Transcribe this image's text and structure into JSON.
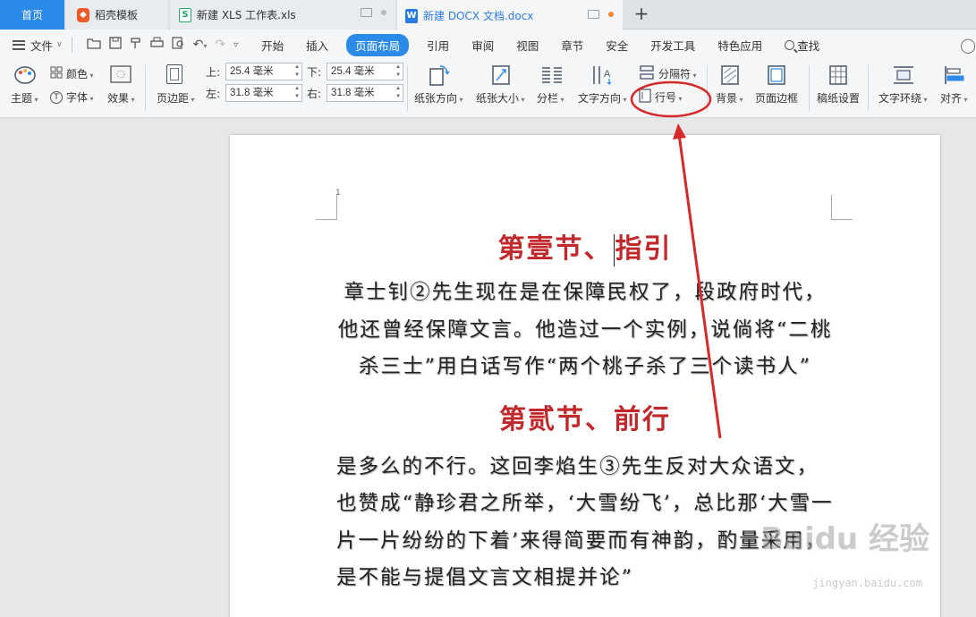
{
  "tabs": {
    "home": "首页",
    "daoke": "稻壳模板",
    "xls": "新建 XLS 工作表.xls",
    "docx": "新建 DOCX 文档.docx",
    "new_tab": "+"
  },
  "menu": {
    "file": "文件",
    "tabs": [
      "开始",
      "插入",
      "页面布局",
      "引用",
      "审阅",
      "视图",
      "章节",
      "安全",
      "开发工具",
      "特色应用"
    ],
    "active_tab": "页面布局",
    "search": "查找"
  },
  "ribbon": {
    "color": "颜色",
    "theme": "主题",
    "font": "字体",
    "effect": "效果",
    "margins": "页边距",
    "top_label": "上:",
    "top_value": "25.4 毫米",
    "bottom_label": "下:",
    "bottom_value": "25.4 毫米",
    "left_label": "左:",
    "left_value": "31.8 毫米",
    "right_label": "右:",
    "right_value": "31.8 毫米",
    "orientation": "纸张方向",
    "size": "纸张大小",
    "columns": "分栏",
    "text_direction": "文字方向",
    "separator": "分隔符",
    "line_number": "行号",
    "background": "背景",
    "page_border": "页面边框",
    "manuscript": "稿纸设置",
    "text_wrap": "文字环绕",
    "align": "对齐"
  },
  "document": {
    "page_number": "1",
    "heading1_a": "第壹节、",
    "heading1_b": "指引",
    "para1": "章士钊②先生现在是在保障民权了，段政府时代，他还曾经保障文言。他造过一个实例，说倘将“二桃杀三士”用白话写作“两个桃子杀了三个读书人”",
    "heading2": "第贰节、前行",
    "para2": "是多么的不行。这回李焰生③先生反对大众语文，也赞成“静珍君之所举，‘大雪纷飞’，总比那‘大雪一片一片纷纷的下着’来得简要而有神韵，酌量采用，是不能与提倡文言文相提并论”"
  },
  "watermark": {
    "brand": "Baidu 经验",
    "url": "jingyan.baidu.com"
  },
  "colors": {
    "accent": "#2c8be8",
    "heading": "#c0282c",
    "annotation": "#d42a2a"
  }
}
